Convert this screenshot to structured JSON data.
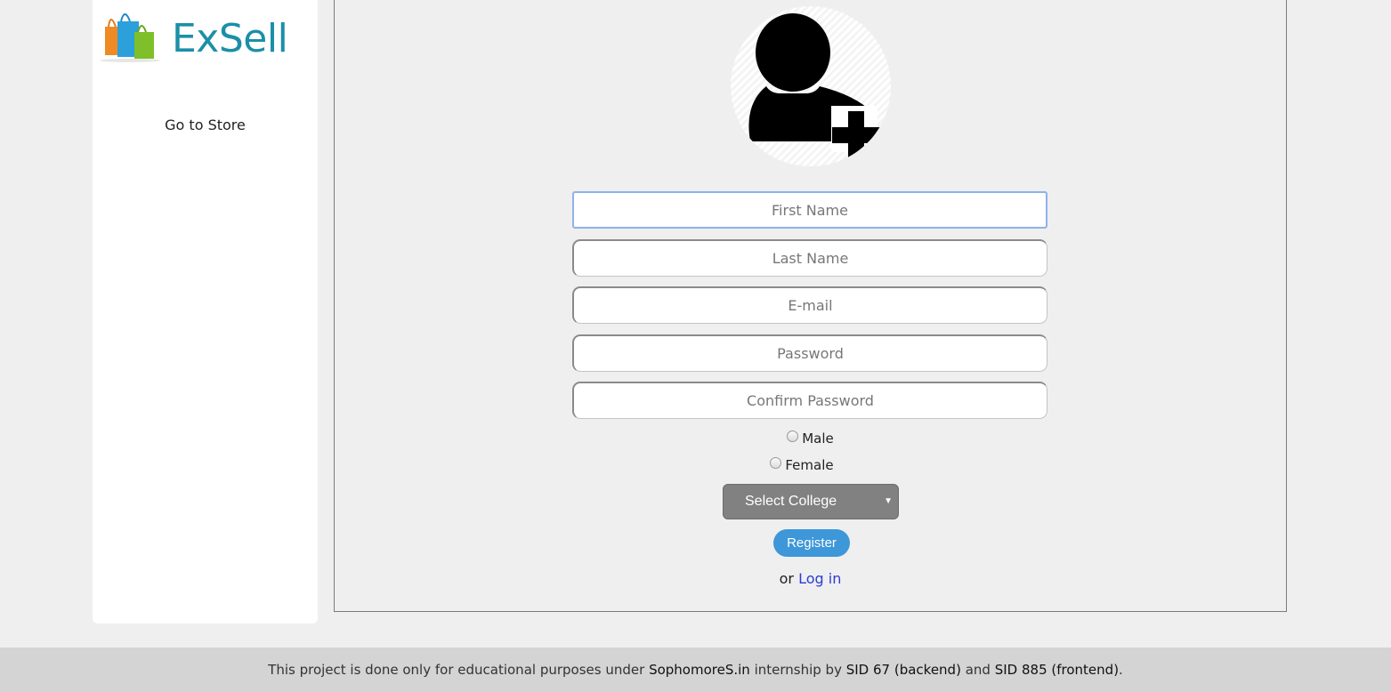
{
  "sidebar": {
    "logo_text": "ExSell",
    "go_to_store": "Go to Store"
  },
  "form": {
    "first_name": {
      "placeholder": "First Name",
      "value": ""
    },
    "last_name": {
      "placeholder": "Last Name",
      "value": ""
    },
    "email": {
      "placeholder": "E-mail",
      "value": ""
    },
    "password": {
      "placeholder": "Password",
      "value": ""
    },
    "confirm_password": {
      "placeholder": "Confirm Password",
      "value": ""
    },
    "gender_male": "Male",
    "gender_female": "Female",
    "college_select": "Select College",
    "register_button": "Register",
    "or_text": "or",
    "login_link": "Log in"
  },
  "footer": {
    "prefix": "This project is done only for educational purposes under",
    "org": "SophomoreS.in",
    "mid": "internship by",
    "sid_backend": "SID 67 (backend)",
    "and": "and",
    "sid_frontend": "SID 885 (frontend)",
    "suffix": "."
  },
  "colors": {
    "brand": "#1b8fa8",
    "register": "#3d97d8",
    "link": "#2c3bd6"
  }
}
